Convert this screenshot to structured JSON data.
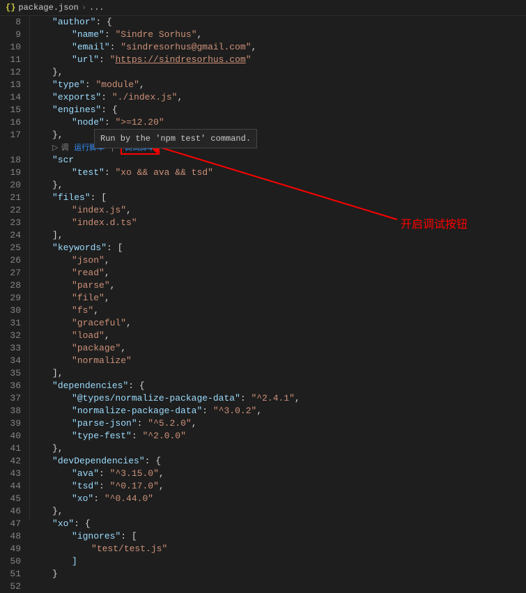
{
  "breadcrumb": {
    "icon": "{}",
    "filename": "package.json",
    "sep": "›",
    "ellipsis": "..."
  },
  "tooltip": {
    "text": "Run by the 'npm test' command."
  },
  "codelens": {
    "runIcon": "▷",
    "debugPrefix": "调",
    "runScript": "运行脚本",
    "sep": "|",
    "debugScript": "调试脚本"
  },
  "annotation": {
    "label": "开启调试按钮"
  },
  "lines": {
    "8": {
      "key": "author",
      "punct": ": {"
    },
    "9": {
      "key": "name",
      "val": "Sindre Sorhus",
      "tail": ","
    },
    "10": {
      "key": "email",
      "val": "sindresorhus@gmail.com",
      "tail": ","
    },
    "11": {
      "key": "url",
      "val": "https://sindresorhus.com"
    },
    "12": {
      "punct": "},"
    },
    "13": {
      "key": "type",
      "val": "module",
      "tail": ","
    },
    "14": {
      "key": "exports",
      "val": "./index.js",
      "tail": ","
    },
    "15": {
      "key": "engines",
      "punct": ": {"
    },
    "16": {
      "key": "node",
      "val": ">=12.20"
    },
    "17": {
      "punct": "},"
    },
    "18": {
      "key": "scr"
    },
    "19": {
      "key": "test",
      "val": "xo && ava && tsd"
    },
    "20": {
      "punct": "},"
    },
    "21": {
      "key": "files",
      "punct": ": ["
    },
    "22": {
      "val": "index.js",
      "tail": ","
    },
    "23": {
      "val": "index.d.ts"
    },
    "24": {
      "punct": "],"
    },
    "25": {
      "key": "keywords",
      "punct": ": ["
    },
    "26": {
      "val": "json",
      "tail": ","
    },
    "27": {
      "val": "read",
      "tail": ","
    },
    "28": {
      "val": "parse",
      "tail": ","
    },
    "29": {
      "val": "file",
      "tail": ","
    },
    "30": {
      "val": "fs",
      "tail": ","
    },
    "31": {
      "val": "graceful",
      "tail": ","
    },
    "32": {
      "val": "load",
      "tail": ","
    },
    "33": {
      "val": "package",
      "tail": ","
    },
    "34": {
      "val": "normalize"
    },
    "35": {
      "punct": "],"
    },
    "36": {
      "key": "dependencies",
      "punct": ": {"
    },
    "37": {
      "key": "@types/normalize-package-data",
      "val": "^2.4.1",
      "tail": ","
    },
    "38": {
      "key": "normalize-package-data",
      "val": "^3.0.2",
      "tail": ","
    },
    "39": {
      "key": "parse-json",
      "val": "^5.2.0",
      "tail": ","
    },
    "40": {
      "key": "type-fest",
      "val": "^2.0.0"
    },
    "41": {
      "punct": "},"
    },
    "42": {
      "key": "devDependencies",
      "punct": ": {"
    },
    "43": {
      "key": "ava",
      "val": "^3.15.0",
      "tail": ","
    },
    "44": {
      "key": "tsd",
      "val": "^0.17.0",
      "tail": ","
    },
    "45": {
      "key": "xo",
      "val": "^0.44.0"
    },
    "46": {
      "punct": "},"
    },
    "47": {
      "key": "xo",
      "punct": ": {"
    },
    "48": {
      "key": "ignores",
      "punct": ": ["
    },
    "49": {
      "val": "test/test.js"
    },
    "50": {
      "punct": "]"
    },
    "51": {
      "punct": "}"
    },
    "52": {
      "punct": ""
    }
  }
}
